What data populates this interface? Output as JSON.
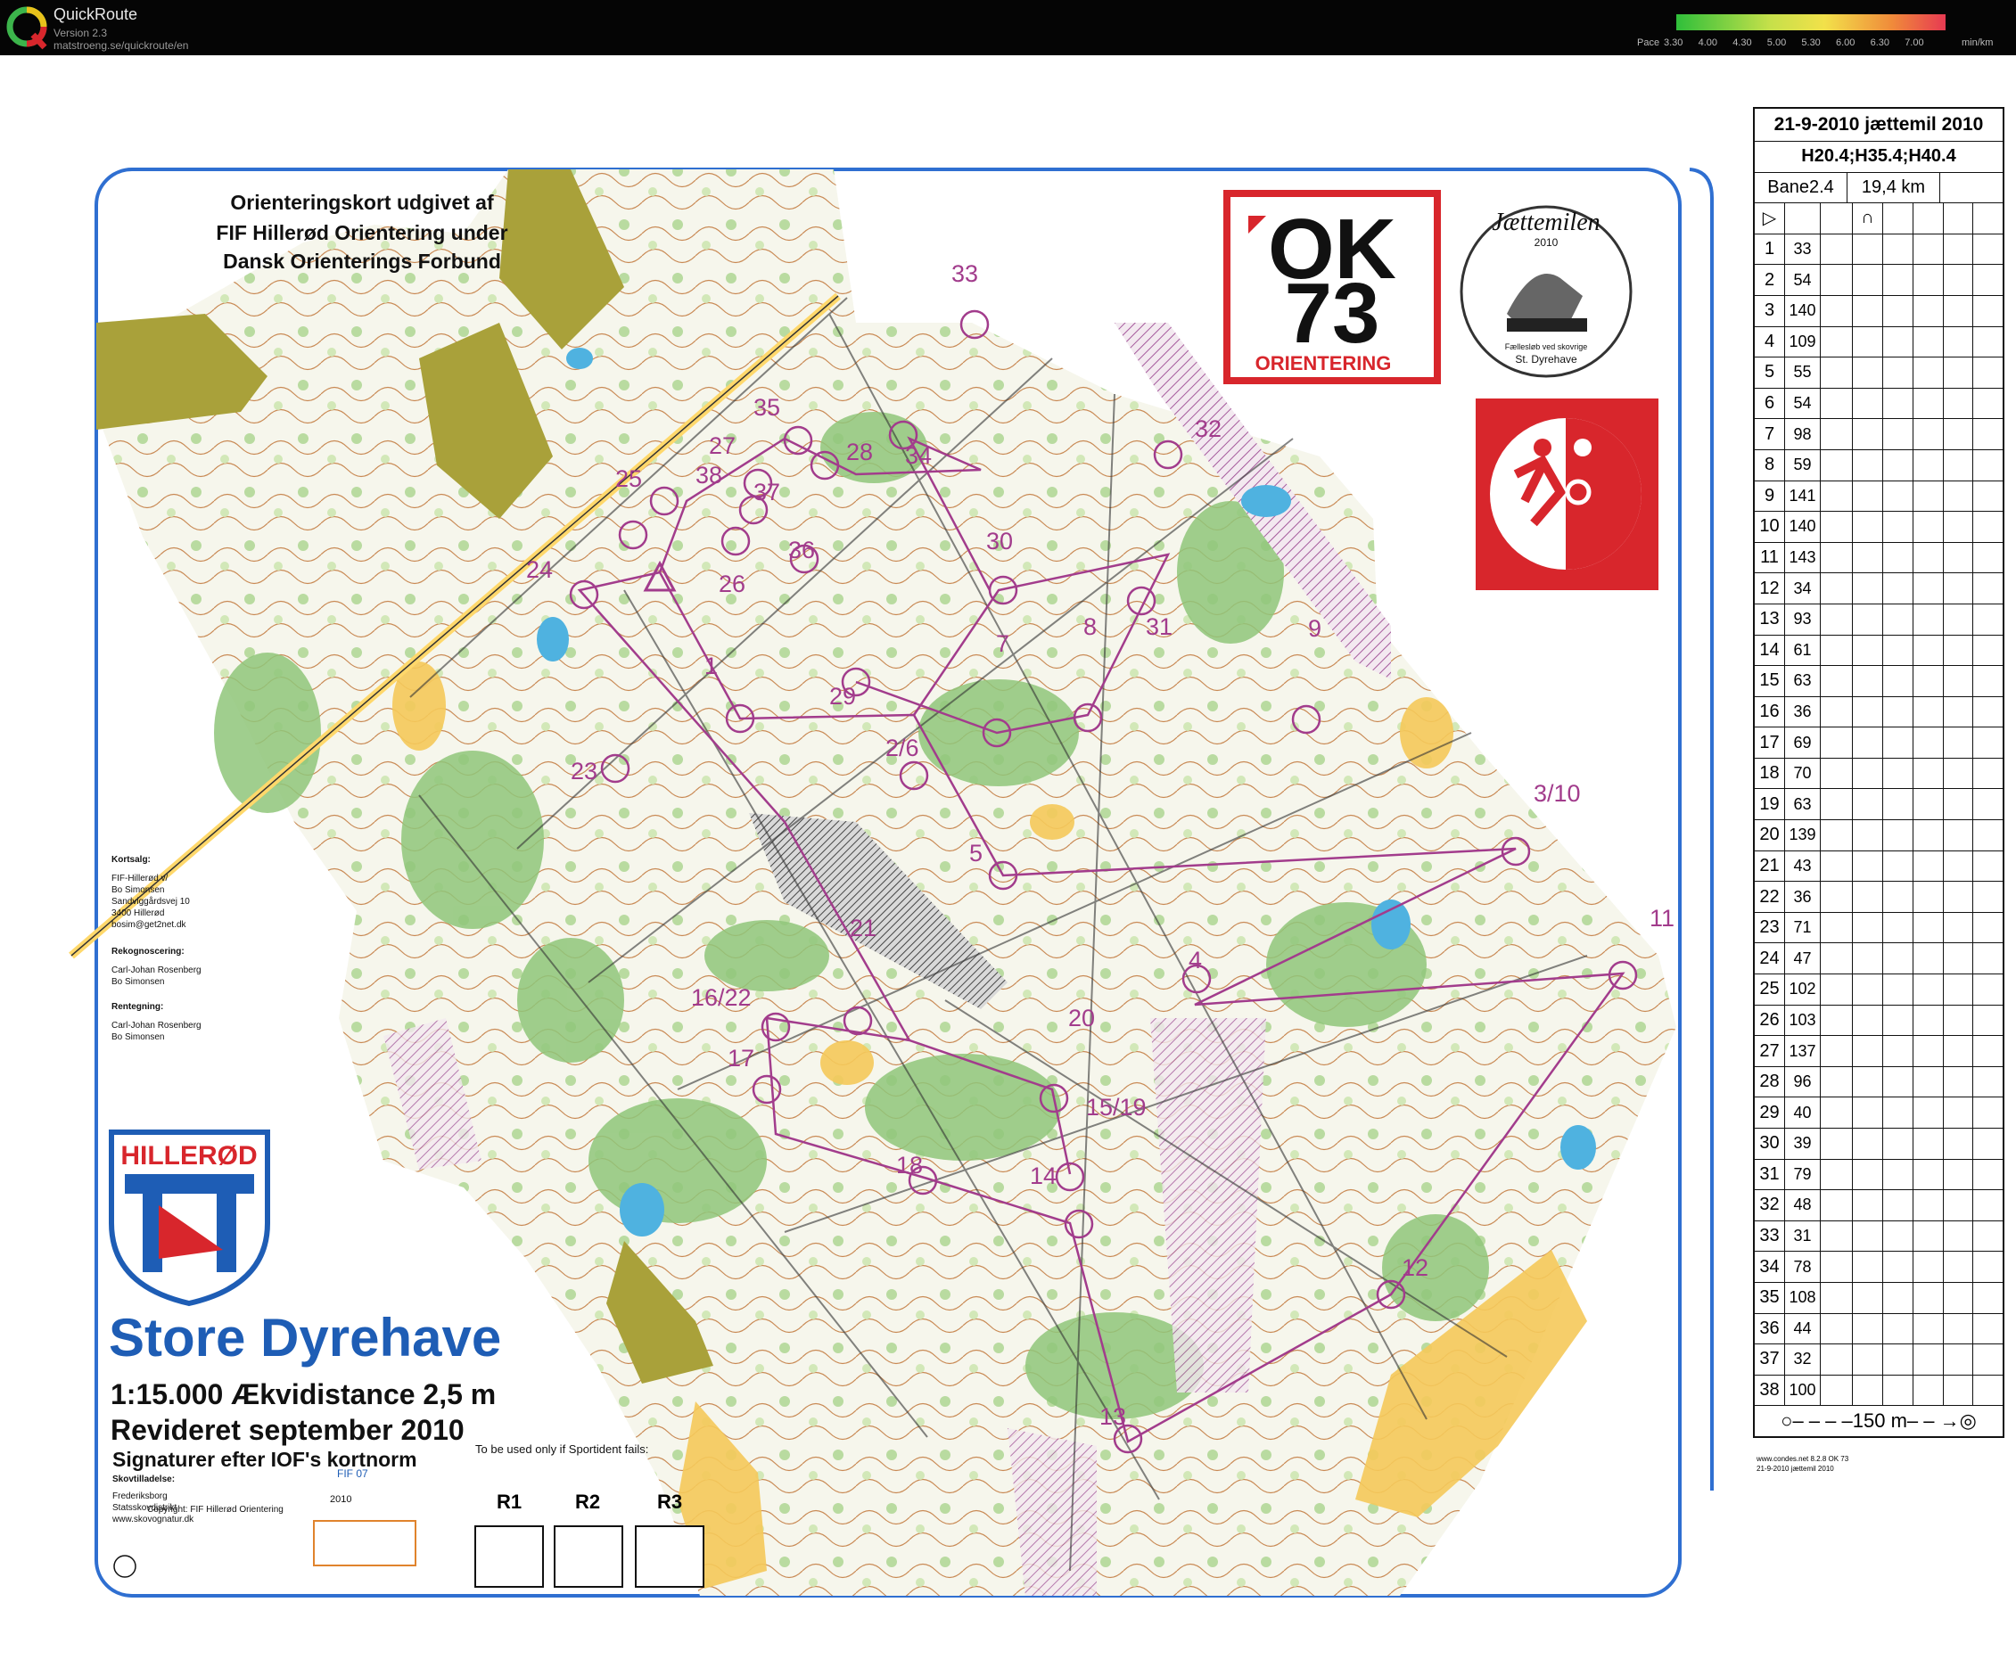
{
  "app": {
    "title": "QuickRoute",
    "version": "Version 2.3",
    "url": "matstroeng.se/quickroute/en",
    "pace_prefix": "Pace",
    "pace_labels": [
      "3.30",
      "4.00",
      "4.30",
      "5.00",
      "5.30",
      "6.00",
      "6.30",
      "7.00"
    ],
    "pace_unit": "min/km"
  },
  "map": {
    "header": [
      "Orienteringskort udgivet af",
      "FIF Hillerød Orientering under",
      "Dansk Orienterings Forbund"
    ],
    "title": "Store Dyrehave",
    "scale_line": "1:15.000  Ækvidistance 2,5 m",
    "revised": "Revideret september 2010",
    "signatures": "Signaturer efter IOF's kortnorm",
    "club_logo_text": "HILLERØD",
    "ok73": {
      "line1": "OK",
      "line2": "73",
      "line3": "ORIENTERING"
    },
    "jaettemilen": {
      "title": "Jættemilen",
      "year": "2010",
      "sub1": "Fællesløb ved skovrige",
      "sub2": "St. Dyrehave"
    },
    "sales": [
      "Kortsalg:",
      "FIF-Hillerød v/",
      "Bo Simonsen",
      "Sandviggårdsvej 10",
      "3400 Hillerød",
      "bosim@get2net.dk"
    ],
    "recon": [
      "Rekognoscering:",
      "Carl-Johan Rosenberg",
      "Bo Simonsen"
    ],
    "drawing": [
      "Rentegning:",
      "Carl-Johan Rosenberg",
      "Bo Simonsen"
    ],
    "permission": [
      "Skovtilladelse:",
      "Frederiksborg",
      "Statsskovdistrikt",
      "www.skovognatur.dk"
    ],
    "copyright": "Copyright: FIF Hillerød Orientering",
    "map_id": "FIF 07",
    "map_year": "2010",
    "backup_label": "To be used only  if Sportident fails:",
    "backup_boxes": [
      "R1",
      "R2",
      "R3"
    ],
    "control_labels": [
      "1",
      "2/6",
      "3/10",
      "4",
      "5",
      "7",
      "8",
      "9",
      "11",
      "12",
      "13",
      "14",
      "15/19",
      "16/22",
      "17",
      "18",
      "20",
      "21",
      "23",
      "24",
      "25",
      "26",
      "27",
      "28",
      "29",
      "30",
      "31",
      "32",
      "33",
      "34",
      "35",
      "36",
      "37",
      "38"
    ]
  },
  "description_sheet": {
    "date_title": "21-9-2010 jættemil 2010",
    "classes": "H20.4;H35.4;H40.4",
    "course": "Bane2.4",
    "distance": "19,4 km",
    "controls": [
      {
        "n": "1",
        "code": "33"
      },
      {
        "n": "2",
        "code": "54"
      },
      {
        "n": "3",
        "code": "140"
      },
      {
        "n": "4",
        "code": "109"
      },
      {
        "n": "5",
        "code": "55"
      },
      {
        "n": "6",
        "code": "54"
      },
      {
        "n": "7",
        "code": "98"
      },
      {
        "n": "8",
        "code": "59"
      },
      {
        "n": "9",
        "code": "141"
      },
      {
        "n": "10",
        "code": "140"
      },
      {
        "n": "11",
        "code": "143"
      },
      {
        "n": "12",
        "code": "34"
      },
      {
        "n": "13",
        "code": "93"
      },
      {
        "n": "14",
        "code": "61"
      },
      {
        "n": "15",
        "code": "63"
      },
      {
        "n": "16",
        "code": "36"
      },
      {
        "n": "17",
        "code": "69"
      },
      {
        "n": "18",
        "code": "70"
      },
      {
        "n": "19",
        "code": "63"
      },
      {
        "n": "20",
        "code": "139"
      },
      {
        "n": "21",
        "code": "43"
      },
      {
        "n": "22",
        "code": "36"
      },
      {
        "n": "23",
        "code": "71"
      },
      {
        "n": "24",
        "code": "47"
      },
      {
        "n": "25",
        "code": "102"
      },
      {
        "n": "26",
        "code": "103"
      },
      {
        "n": "27",
        "code": "137"
      },
      {
        "n": "28",
        "code": "96"
      },
      {
        "n": "29",
        "code": "40"
      },
      {
        "n": "30",
        "code": "39"
      },
      {
        "n": "31",
        "code": "79"
      },
      {
        "n": "32",
        "code": "48"
      },
      {
        "n": "33",
        "code": "31"
      },
      {
        "n": "34",
        "code": "78"
      },
      {
        "n": "35",
        "code": "108"
      },
      {
        "n": "36",
        "code": "44"
      },
      {
        "n": "37",
        "code": "32"
      },
      {
        "n": "38",
        "code": "100"
      }
    ],
    "finish": "150 m",
    "footer1": "www.condes.net 8.2.8 OK 73",
    "footer2": "21-9-2010 jættemil 2010"
  }
}
